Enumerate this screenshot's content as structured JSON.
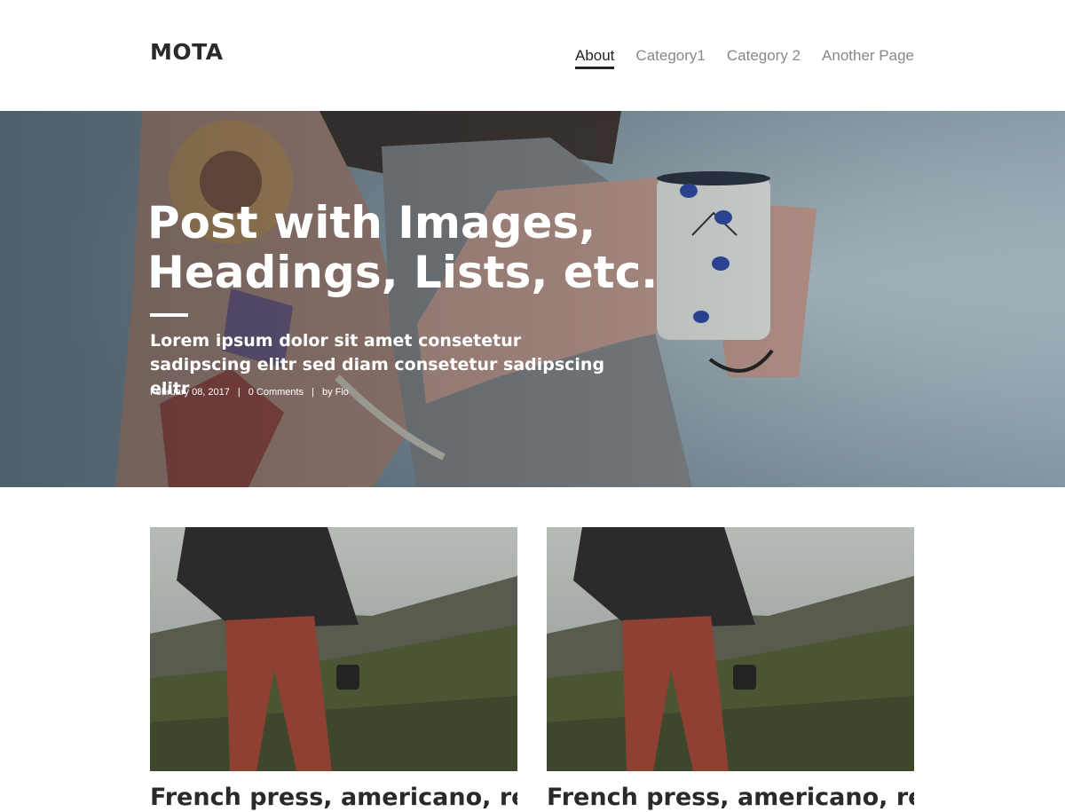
{
  "site": {
    "title": "MOTA"
  },
  "nav": {
    "items": [
      {
        "label": "About",
        "active": true
      },
      {
        "label": "Category1",
        "active": false
      },
      {
        "label": "Category 2",
        "active": false
      },
      {
        "label": "Another Page",
        "active": false
      }
    ]
  },
  "hero": {
    "title": "Post with Images, Headings, Lists, etc.",
    "subtitle": "Lorem ipsum dolor sit amet consetetur sadipscing elitr sed diam consetetur sadipscing elitr",
    "meta": {
      "date": "February 08, 2017",
      "comments": "0 Comments",
      "author": "by Flo"
    }
  },
  "posts": [
    {
      "title": "French press, americano, redeye"
    },
    {
      "title": "French press, americano, redeye"
    }
  ],
  "colors": {
    "text": "#222222",
    "nav_inactive": "#888888",
    "hero_overlay": "#1e2a35"
  }
}
